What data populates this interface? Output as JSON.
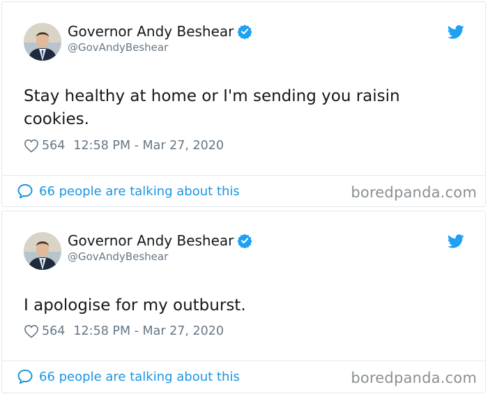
{
  "tweets": [
    {
      "name": "Governor Andy Beshear",
      "handle": "@GovAndyBeshear",
      "text": "Stay healthy at home or I'm sending you raisin cookies.",
      "likes": "564",
      "timestamp": "12:58 PM - Mar 27, 2020",
      "talking": "66 people are talking about this"
    },
    {
      "name": "Governor Andy Beshear",
      "handle": "@GovAndyBeshear",
      "text": "I apologise for my outburst.",
      "likes": "564",
      "timestamp": "12:58 PM - Mar 27, 2020",
      "talking": "66 people are talking about this"
    }
  ],
  "watermark": "boredpanda.com",
  "colors": {
    "twitter_blue": "#1da1f2",
    "link_blue": "#1b95e0",
    "meta_gray": "#657786",
    "border": "#e1e8ed"
  },
  "icons": [
    "verified-badge-icon",
    "twitter-bird-icon",
    "heart-icon",
    "speech-bubble-icon"
  ]
}
